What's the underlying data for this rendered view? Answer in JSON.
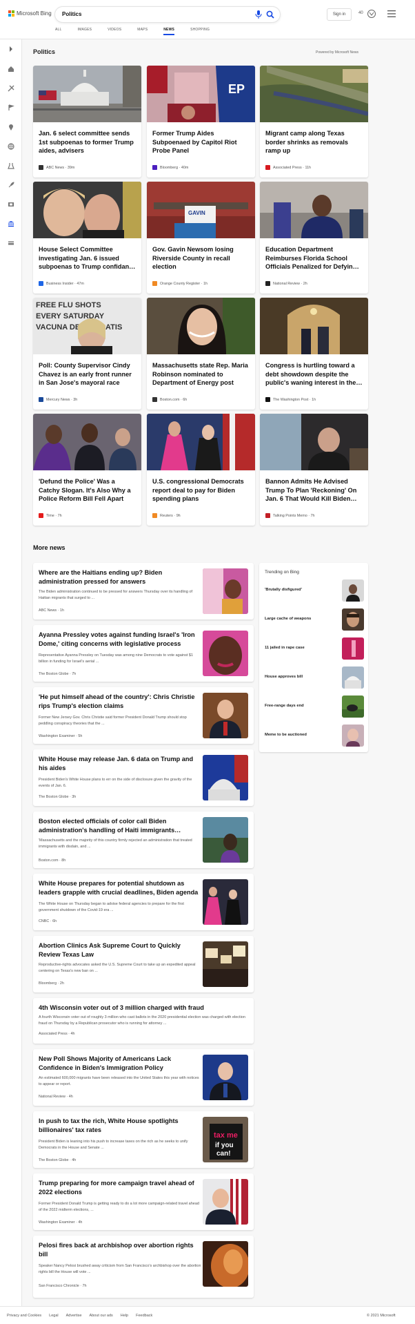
{
  "header": {
    "logo_text": "Microsoft Bing",
    "search_value": "Politics",
    "sign_in": "Sign in",
    "points": "40",
    "tabs": [
      {
        "label": "ALL"
      },
      {
        "label": "IMAGES"
      },
      {
        "label": "VIDEOS"
      },
      {
        "label": "MAPS"
      },
      {
        "label": "NEWS"
      },
      {
        "label": "SHOPPING"
      }
    ]
  },
  "sidebar_icons": [
    "expand-icon",
    "home-icon",
    "sports-icon",
    "flag-icon",
    "location-icon",
    "globe-icon",
    "science-icon",
    "rocket-icon",
    "entertainment-icon",
    "politics-icon",
    "money-icon"
  ],
  "top": {
    "title": "Politics",
    "powered": "Powered by Microsoft News",
    "cards": [
      {
        "title": "Jan. 6 select committee sends 1st subpoenas to former Trump aides, advisers",
        "source": "ABC News",
        "time": "39m"
      },
      {
        "title": "Former Trump Aides Subpoenaed by Capitol Riot Probe Panel",
        "source": "Bloomberg",
        "time": "40m"
      },
      {
        "title": "Migrant camp along Texas border shrinks as removals ramp up",
        "source": "Associated Press",
        "time": "11h"
      },
      {
        "title": "House Select Committee investigating Jan. 6 issued subpoenas to Trump confidan…",
        "source": "Business Insider",
        "time": "47m"
      },
      {
        "title": "Gov. Gavin Newsom losing Riverside County in recall election",
        "source": "Orange County Register",
        "time": "1h"
      },
      {
        "title": "Education Department Reimburses Florida School Officials Penalized for Defyin…",
        "source": "National Review",
        "time": "2h"
      },
      {
        "title": "Poll: County Supervisor Cindy Chavez is an early front runner in San Jose's mayoral race",
        "source": "Mercury News",
        "time": "3h"
      },
      {
        "title": "Massachusetts state Rep. Maria Robinson nominated to Department of Energy post",
        "source": "Boston.com",
        "time": "6h"
      },
      {
        "title": "Congress is hurtling toward a debt showdown despite the public's waning interest in the…",
        "source": "The Washington Post",
        "time": "1h"
      },
      {
        "title": "'Defund the Police' Was a Catchy Slogan. It's Also Why a Police Reform Bill Fell Apart",
        "source": "Time",
        "time": "7h"
      },
      {
        "title": "U.S. congressional Democrats report deal to pay for Biden spending plans",
        "source": "Reuters",
        "time": "9h"
      },
      {
        "title": "Bannon Admits He Advised Trump To Plan 'Reckoning' On Jan. 6 That Would Kill Biden…",
        "source": "Talking Points Memo",
        "time": "7h"
      }
    ]
  },
  "more": {
    "title": "More news",
    "items": [
      {
        "title": "Where are the Haitians ending up? Biden administration pressed for answers",
        "desc": "The Biden administration continued to be pressed for answers Thursday over its handling of Haitian migrants that surged to ...",
        "source": "ABC News",
        "time": "1h"
      },
      {
        "title": "Ayanna Pressley votes against funding Israel's 'Iron Dome,' citing concerns with legislative process",
        "desc": "Representative Ayanna Pressley on Tuesday was among nine Democrats to vote against $1 billion in funding for Israel's aerial ...",
        "source": "The Boston Globe",
        "time": "7h"
      },
      {
        "title": "'He put himself ahead of the country': Chris Christie rips Trump's election claims",
        "desc": "Former New Jersey Gov. Chris Christie said former President Donald Trump should stop peddling conspiracy theories that the ...",
        "source": "Washington Examiner",
        "time": "5h"
      },
      {
        "title": "White House may release Jan. 6 data on Trump and his aides",
        "desc": "President Biden's White House plans to err on the side of disclosure given the gravity of the events of Jan. 6.",
        "source": "The Boston Globe",
        "time": "3h"
      },
      {
        "title": "Boston elected officials of color call Biden administration's handling of Haiti immigrants…",
        "desc": "'Massachusetts and the majority of this country firmly rejected an administration that treated immigrants with disdain, and ...",
        "source": "Boston.com",
        "time": "8h"
      },
      {
        "title": "White House prepares for potential shutdown as leaders grapple with crucial deadlines, Biden agenda",
        "desc": "The White House on Thursday began to advise federal agencies to prepare for the first government shutdown of the Covid-19 era ...",
        "source": "CNBC",
        "time": "6h"
      },
      {
        "title": "Abortion Clinics Ask Supreme Court to Quickly Review Texas Law",
        "desc": "Reproductive-rights advocates asked the U.S. Supreme Court to take up an expedited appeal centering on Texas's new ban on ...",
        "source": "Bloomberg",
        "time": "2h"
      },
      {
        "title": "4th Wisconsin voter out of 3 million charged with fraud",
        "desc": "A fourth Wisconsin voter out of roughly 3 million who cast ballots in the 2020 presidential election was charged with election fraud on Thursday by a Republican prosecutor who is running for attorney ...",
        "source": "Associated Press",
        "time": "4h"
      },
      {
        "title": "New Poll Shows Majority of Americans Lack Confidence in Biden's Immigration Policy",
        "desc": "An estimated 600,000 migrants have been released into the United States this year with notices to appear or report.",
        "source": "National Review",
        "time": "4h"
      },
      {
        "title": "In push to tax the rich, White House spotlights billionaires' tax rates",
        "desc": "President Biden is leaning into his push to increase taxes on the rich as he seeks to unify Democrats in the House and Senate ...",
        "source": "The Boston Globe",
        "time": "4h"
      },
      {
        "title": "Trump preparing for more campaign travel ahead of 2022 elections",
        "desc": "Former President Donald Trump is getting ready to do a lot more campaign-related travel ahead of the 2022 midterm elections, ...",
        "source": "Washington Examiner",
        "time": "4h"
      },
      {
        "title": "Pelosi fires back at archbishop over abortion rights bill",
        "desc": "Speaker Nancy Pelosi brushed away criticism from San Francisco's archbishop over the abortion rights bill the House will vote ...",
        "source": "San Francisco Chronicle",
        "time": "7h"
      }
    ]
  },
  "trending": {
    "title": "Trending on Bing",
    "items": [
      {
        "label": "'Brutally disfigured'"
      },
      {
        "label": "Large cache of weapons"
      },
      {
        "label": "11 jailed in rape case"
      },
      {
        "label": "House approves bill"
      },
      {
        "label": "Free-range days end"
      },
      {
        "label": "Meme to be auctioned"
      }
    ]
  },
  "footer": {
    "links": [
      "Privacy and Cookies",
      "Legal",
      "Advertise",
      "About our ads",
      "Help",
      "Feedback"
    ],
    "copyright": "© 2021 Microsoft"
  }
}
